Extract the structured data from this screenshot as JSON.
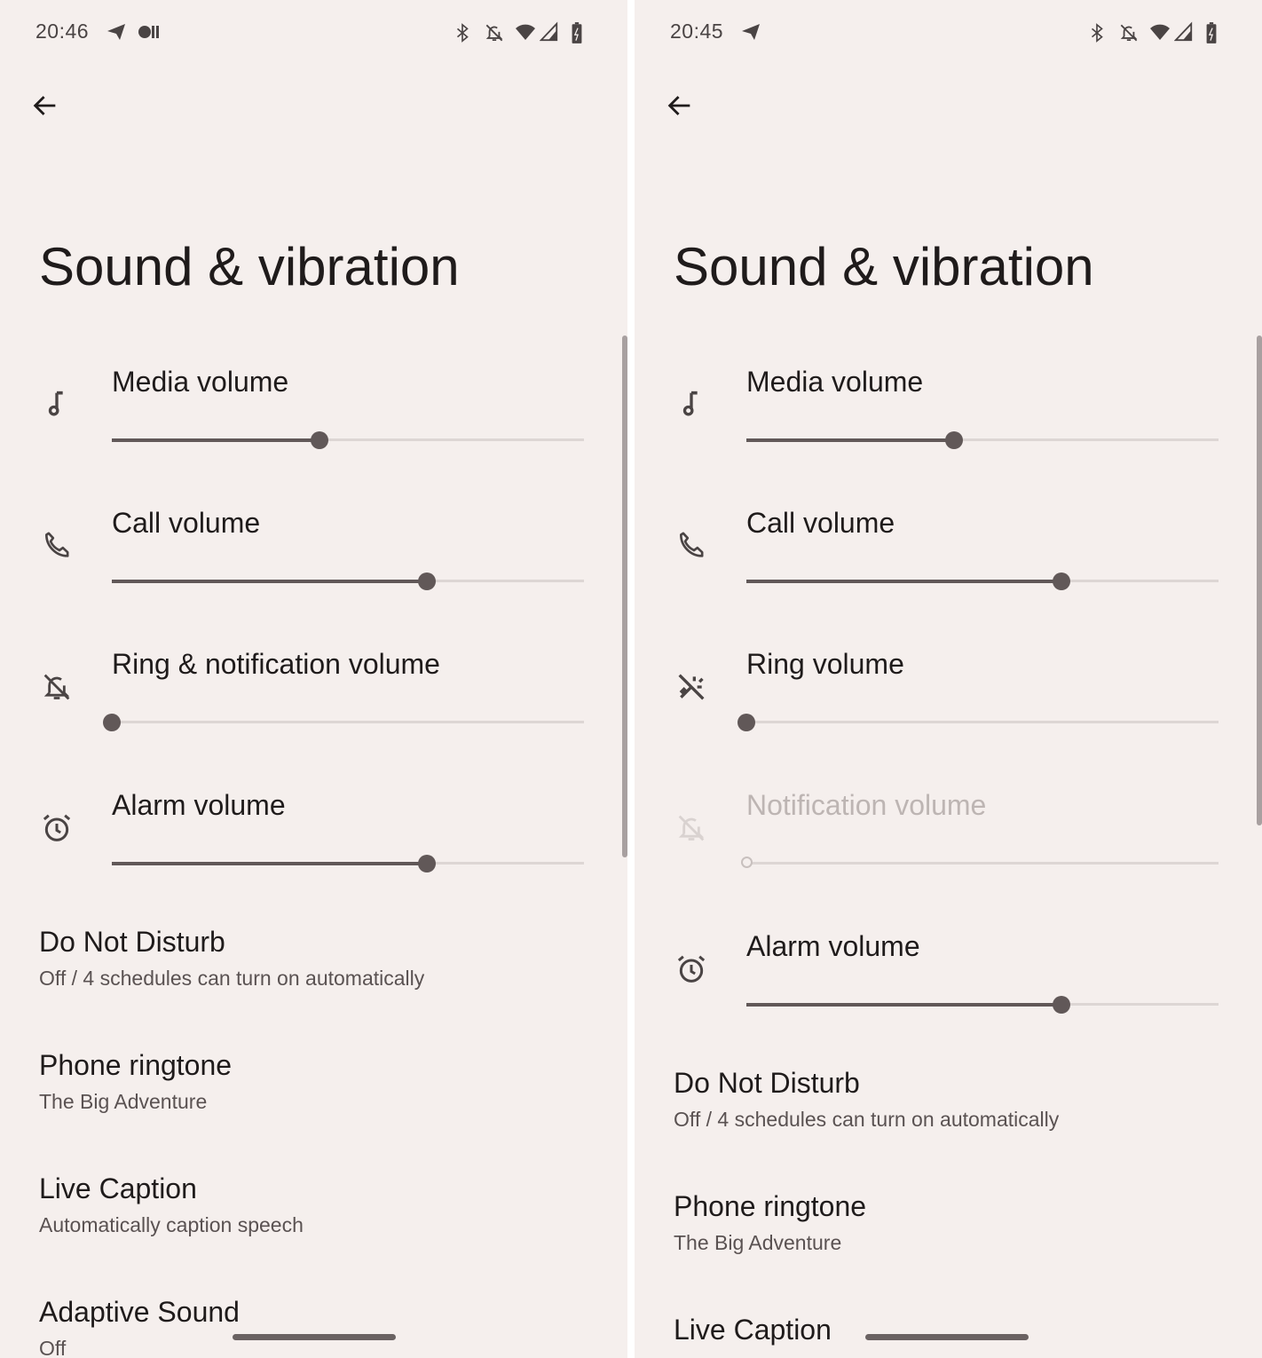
{
  "colors": {
    "background": "#f5efed",
    "accent": "#615858",
    "track": "#ddd6d4",
    "disabled": "#bdb5b3"
  },
  "panels": [
    {
      "status": {
        "time": "20:46",
        "icons": [
          "telegram-icon",
          "pill-icon",
          "bluetooth-icon",
          "bell-off-icon",
          "wifi-icon",
          "signal-icon",
          "battery-charging-icon"
        ]
      },
      "back_icon": "arrow-left-icon",
      "title": "Sound & vibration",
      "sliders": [
        {
          "label": "Media volume",
          "icon": "music-note-icon",
          "value": 0.44,
          "enabled": true
        },
        {
          "label": "Call volume",
          "icon": "phone-icon",
          "value": 0.667,
          "enabled": true
        },
        {
          "label": "Ring & notification volume",
          "icon": "bell-off-icon",
          "value": 0,
          "enabled": true
        },
        {
          "label": "Alarm volume",
          "icon": "alarm-icon",
          "value": 0.667,
          "enabled": true
        }
      ],
      "items": [
        {
          "title": "Do Not Disturb",
          "subtitle": "Off / 4 schedules can turn on automatically"
        },
        {
          "title": "Phone ringtone",
          "subtitle": "The Big Adventure"
        },
        {
          "title": "Live Caption",
          "subtitle": "Automatically caption speech"
        },
        {
          "title": "Adaptive Sound",
          "subtitle": "Off"
        }
      ]
    },
    {
      "status": {
        "time": "20:45",
        "icons": [
          "telegram-icon",
          "bluetooth-icon",
          "bell-off-icon",
          "wifi-icon",
          "signal-icon",
          "battery-charging-icon"
        ]
      },
      "back_icon": "arrow-left-icon",
      "title": "Sound & vibration",
      "sliders": [
        {
          "label": "Media volume",
          "icon": "music-note-icon",
          "value": 0.44,
          "enabled": true
        },
        {
          "label": "Call volume",
          "icon": "phone-icon",
          "value": 0.667,
          "enabled": true
        },
        {
          "label": "Ring volume",
          "icon": "vibrate-off-icon",
          "value": 0,
          "enabled": true
        },
        {
          "label": "Notification volume",
          "icon": "bell-off-icon",
          "value": 0,
          "enabled": false
        },
        {
          "label": "Alarm volume",
          "icon": "alarm-icon",
          "value": 0.667,
          "enabled": true
        }
      ],
      "items": [
        {
          "title": "Do Not Disturb",
          "subtitle": "Off / 4 schedules can turn on automatically"
        },
        {
          "title": "Phone ringtone",
          "subtitle": "The Big Adventure"
        },
        {
          "title": "Live Caption",
          "subtitle": ""
        }
      ]
    }
  ]
}
